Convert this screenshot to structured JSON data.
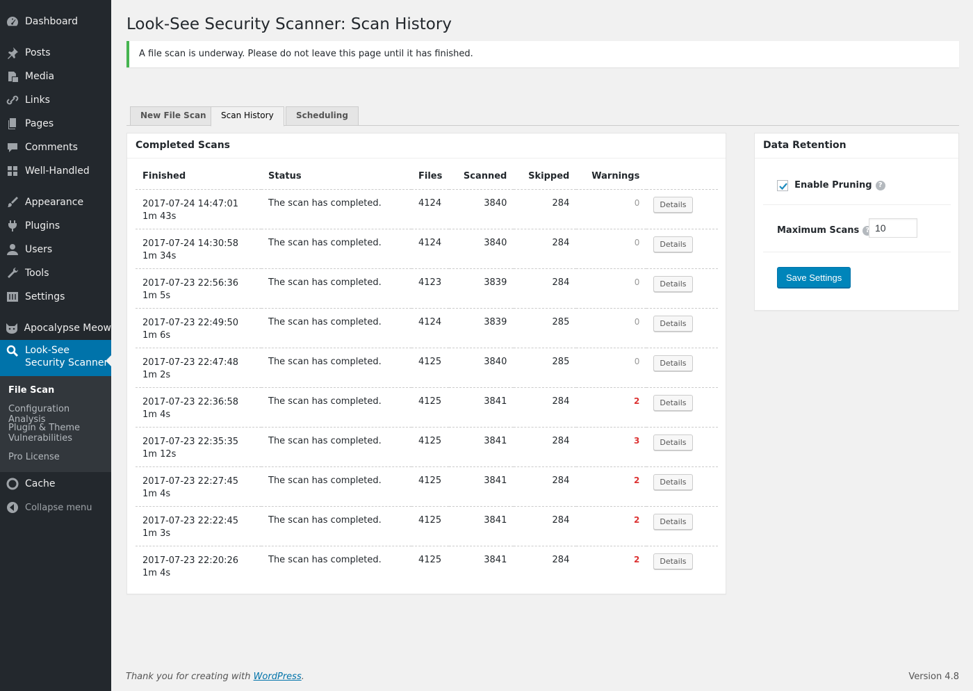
{
  "sidebar": {
    "items": [
      {
        "label": "Dashboard",
        "icon": "dashboard-icon"
      },
      {
        "label": "Posts",
        "icon": "pushpin-icon"
      },
      {
        "label": "Media",
        "icon": "media-icon"
      },
      {
        "label": "Links",
        "icon": "link-icon"
      },
      {
        "label": "Pages",
        "icon": "pages-icon"
      },
      {
        "label": "Comments",
        "icon": "comment-icon"
      },
      {
        "label": "Well-Handled",
        "icon": "grid-icon"
      },
      {
        "label": "Appearance",
        "icon": "paintbrush-icon"
      },
      {
        "label": "Plugins",
        "icon": "plugin-icon"
      },
      {
        "label": "Users",
        "icon": "user-icon"
      },
      {
        "label": "Tools",
        "icon": "wrench-icon"
      },
      {
        "label": "Settings",
        "icon": "settings-icon"
      },
      {
        "label": "Apocalypse Meow",
        "icon": "cat-icon"
      },
      {
        "label": "Look-See Security Scanner",
        "icon": "search-icon"
      },
      {
        "label": "Cache",
        "icon": "circle-icon"
      }
    ],
    "submenu": [
      "File Scan",
      "Configuration Analysis",
      "Plugin & Theme Vulnerabilities",
      "Pro License"
    ],
    "collapse_label": "Collapse menu"
  },
  "page": {
    "title": "Look-See Security Scanner: Scan History",
    "notice": "A file scan is underway. Please do not leave this page until it has finished."
  },
  "tabs": [
    "New File Scan",
    "Scan History",
    "Scheduling"
  ],
  "scans": {
    "title": "Completed Scans",
    "columns": [
      "Finished",
      "Status",
      "Files",
      "Scanned",
      "Skipped",
      "Warnings"
    ],
    "details_label": "Details",
    "rows": [
      {
        "finished": "2017-07-24 14:47:01",
        "duration": "1m 43s",
        "status": "The scan has completed.",
        "files": "4124",
        "scanned": "3840",
        "skipped": "284",
        "warnings": "0"
      },
      {
        "finished": "2017-07-24 14:30:58",
        "duration": "1m 34s",
        "status": "The scan has completed.",
        "files": "4124",
        "scanned": "3840",
        "skipped": "284",
        "warnings": "0"
      },
      {
        "finished": "2017-07-23 22:56:36",
        "duration": "1m 5s",
        "status": "The scan has completed.",
        "files": "4123",
        "scanned": "3839",
        "skipped": "284",
        "warnings": "0"
      },
      {
        "finished": "2017-07-23 22:49:50",
        "duration": "1m 6s",
        "status": "The scan has completed.",
        "files": "4124",
        "scanned": "3839",
        "skipped": "285",
        "warnings": "0"
      },
      {
        "finished": "2017-07-23 22:47:48",
        "duration": "1m 2s",
        "status": "The scan has completed.",
        "files": "4125",
        "scanned": "3840",
        "skipped": "285",
        "warnings": "0"
      },
      {
        "finished": "2017-07-23 22:36:58",
        "duration": "1m 4s",
        "status": "The scan has completed.",
        "files": "4125",
        "scanned": "3841",
        "skipped": "284",
        "warnings": "2"
      },
      {
        "finished": "2017-07-23 22:35:35",
        "duration": "1m 12s",
        "status": "The scan has completed.",
        "files": "4125",
        "scanned": "3841",
        "skipped": "284",
        "warnings": "3"
      },
      {
        "finished": "2017-07-23 22:27:45",
        "duration": "1m 4s",
        "status": "The scan has completed.",
        "files": "4125",
        "scanned": "3841",
        "skipped": "284",
        "warnings": "2"
      },
      {
        "finished": "2017-07-23 22:22:45",
        "duration": "1m 3s",
        "status": "The scan has completed.",
        "files": "4125",
        "scanned": "3841",
        "skipped": "284",
        "warnings": "2"
      },
      {
        "finished": "2017-07-23 22:20:26",
        "duration": "1m 4s",
        "status": "The scan has completed.",
        "files": "4125",
        "scanned": "3841",
        "skipped": "284",
        "warnings": "2"
      }
    ]
  },
  "retention": {
    "title": "Data Retention",
    "enable_pruning_label": "Enable Pruning",
    "enable_pruning_checked": true,
    "max_scans_label": "Maximum Scans",
    "max_scans_value": "10",
    "help_glyph": "?",
    "save_label": "Save Settings"
  },
  "footer": {
    "thanks_prefix": "Thank you for creating with ",
    "thanks_link": "WordPress",
    "thanks_suffix": ".",
    "version": "Version 4.8"
  },
  "colors": {
    "sidebar_bg": "#23282d",
    "accent": "#0073aa",
    "notice_success": "#46b450",
    "warning": "#dc3232"
  }
}
